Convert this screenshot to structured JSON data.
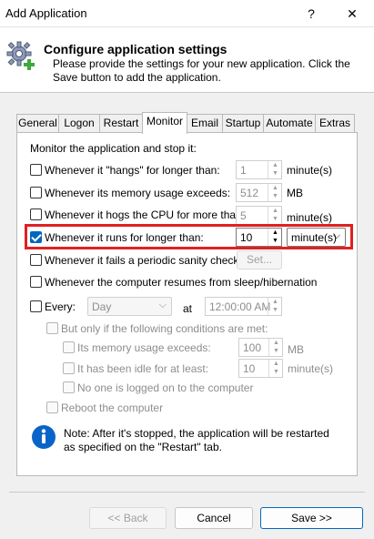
{
  "window": {
    "title": "Add Application",
    "help_button": "?",
    "close_button": "✕"
  },
  "header": {
    "title": "Configure application settings",
    "description": "Please provide the settings for your new application. Click the Save button to add the application."
  },
  "tabs": [
    "General",
    "Logon",
    "Restart",
    "Monitor",
    "Email",
    "Startup",
    "Automate",
    "Extras"
  ],
  "active_tab": "Monitor",
  "monitor": {
    "intro": "Monitor the application and stop it:",
    "hangs": {
      "label": "Whenever it \"hangs\" for longer than:",
      "value": "1",
      "unit": "minute(s)",
      "checked": false
    },
    "memory": {
      "label": "Whenever its memory usage exceeds:",
      "value": "512",
      "unit": "MB",
      "checked": false
    },
    "cpu": {
      "label": "Whenever it hogs the CPU for more than:",
      "value": "5",
      "unit": "minute(s)",
      "checked": false
    },
    "runtime": {
      "label": "Whenever it runs for longer than:",
      "value": "10",
      "unit": "minute(s)",
      "checked": true
    },
    "sanity": {
      "label": "Whenever it fails a periodic sanity check",
      "button": "Set...",
      "checked": false
    },
    "resume": {
      "label": "Whenever the computer resumes from sleep/hibernation",
      "checked": false
    },
    "every": {
      "label": "Every:",
      "period": "Day",
      "at_label": "at",
      "time": "12:00:00 AM",
      "checked": false
    },
    "conditions": {
      "label": "But only if the following conditions are met:",
      "mem_label": "Its memory usage exceeds:",
      "mem_value": "100",
      "mem_unit": "MB",
      "idle_label": "It has been idle for at least:",
      "idle_value": "10",
      "idle_unit": "minute(s)",
      "nologon_label": "No one is logged on to the computer"
    },
    "reboot_label": "Reboot the computer",
    "note": "Note: After it's stopped, the application will be restarted as specified on the \"Restart\" tab."
  },
  "buttons": {
    "back": "<< Back",
    "cancel": "Cancel",
    "save": "Save >>"
  },
  "colors": {
    "accent": "#0067c0",
    "highlight": "#e02020",
    "info": "#0a64c8"
  }
}
